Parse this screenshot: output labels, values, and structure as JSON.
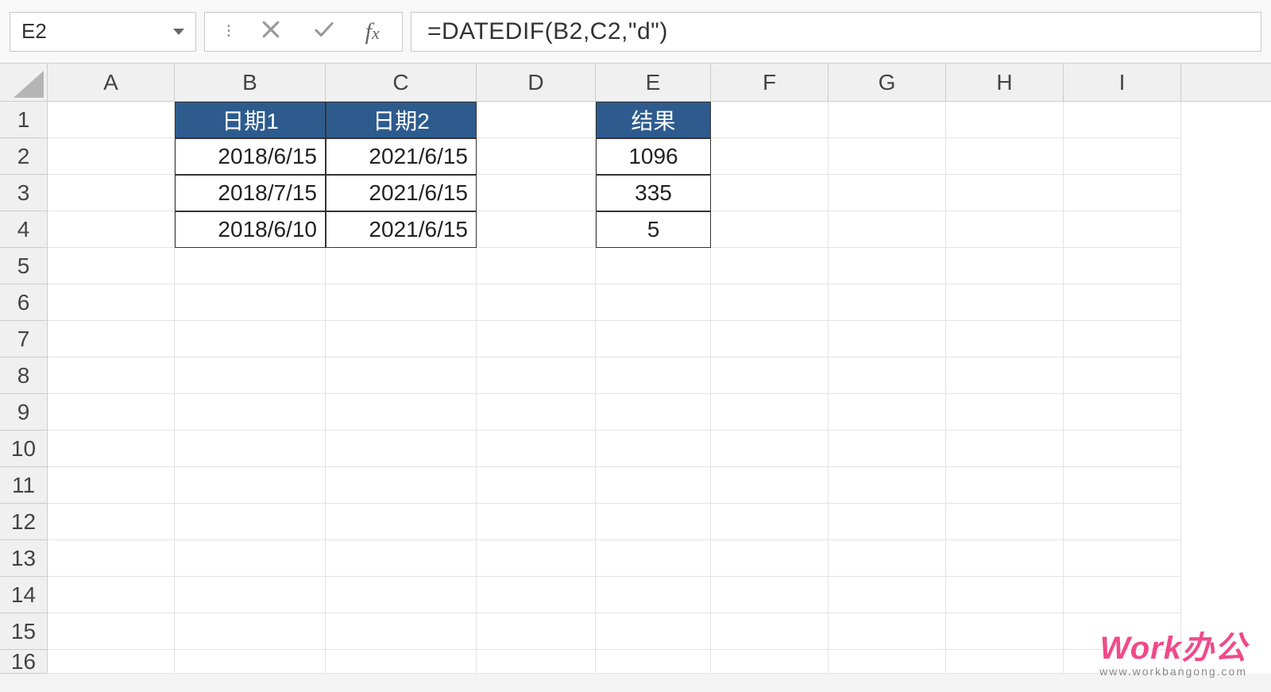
{
  "name_box": "E2",
  "formula": "=DATEDIF(B2,C2,\"d\")",
  "columns": [
    "A",
    "B",
    "C",
    "D",
    "E",
    "F",
    "G",
    "H",
    "I"
  ],
  "rows": [
    "1",
    "2",
    "3",
    "4",
    "5",
    "6",
    "7",
    "8",
    "9",
    "10",
    "11",
    "12",
    "13",
    "14",
    "15",
    "16"
  ],
  "headers": {
    "b1": "日期1",
    "c1": "日期2",
    "e1": "结果"
  },
  "cells": {
    "b2": "2018/6/15",
    "c2": "2021/6/15",
    "e2": "1096",
    "b3": "2018/7/15",
    "c3": "2021/6/15",
    "e3": "335",
    "b4": "2018/6/10",
    "c4": "2021/6/15",
    "e4": "5"
  },
  "watermark": {
    "line1": "Work办公",
    "line2": "www.workbangong.com"
  }
}
